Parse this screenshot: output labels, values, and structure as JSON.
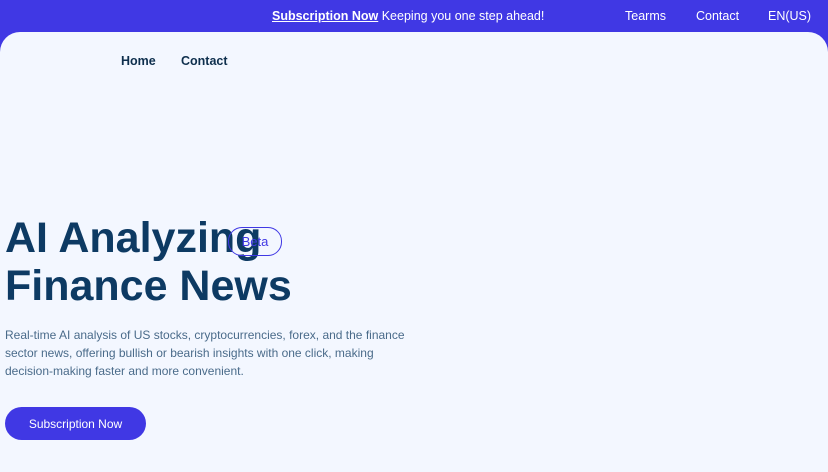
{
  "announcement": {
    "link_label": "Subscription Now",
    "message": " Keeping you one step ahead!"
  },
  "top_links": {
    "terms": "Tearms",
    "contact": "Contact",
    "language": "EN(US)"
  },
  "nav": {
    "home": "Home",
    "contact": "Contact"
  },
  "hero": {
    "title_line1": "AI Analyzing",
    "title_line2": "Finance News",
    "badge": "Beta",
    "description": "Real-time AI analysis of US stocks, cryptocurrencies, forex, and the finance sector news, offering bullish or bearish insights with one click, making decision-making faster and more convenient.",
    "cta_label": "Subscription Now"
  },
  "colors": {
    "primary": "#4038e4",
    "panel_background": "#f3f7ff",
    "heading": "#0d3a63",
    "body_text": "#4a6b8a"
  }
}
